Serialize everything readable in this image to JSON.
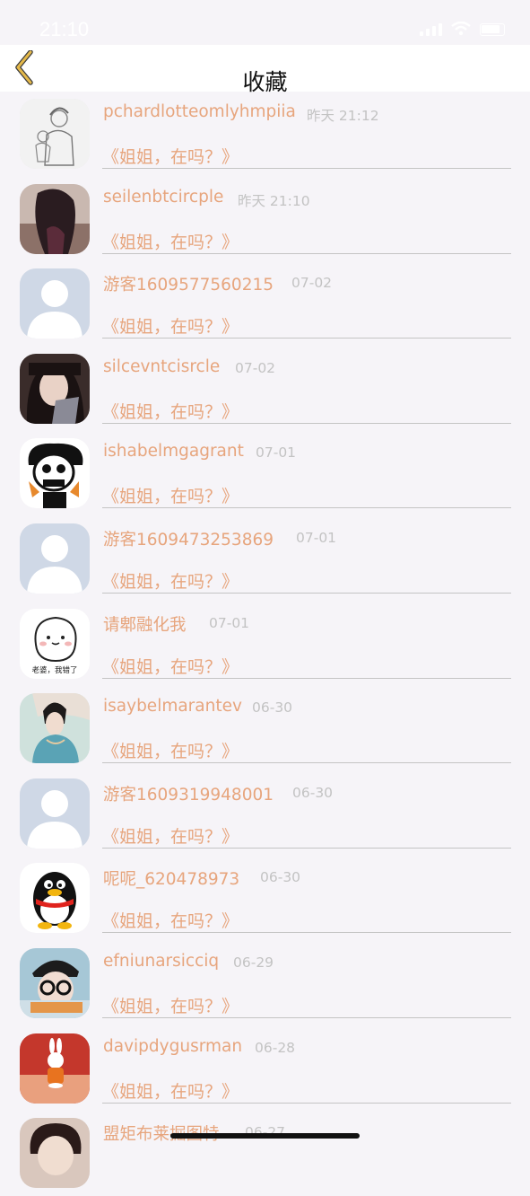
{
  "status_bar": {
    "time": "21:10",
    "icons": [
      "signal-icon",
      "wifi-icon",
      "battery-icon"
    ]
  },
  "nav": {
    "back_icon": "chevron-left-icon",
    "title": "收藏"
  },
  "colors": {
    "accent": "#e7a57d",
    "timestamp": "#c3c3c3",
    "divider": "#c4c4c4",
    "back_chevron": "#e5b94a"
  },
  "favorites": [
    {
      "name": "pchardlotteomlyhmpiia",
      "time": "昨天 21:12",
      "message": "《姐姐，在吗？》",
      "avatar": "sketch-mother-child-avatar"
    },
    {
      "name": "seilenbtcircple",
      "time": "昨天 21:10",
      "message": "《姐姐，在吗？》",
      "avatar": "girl-long-hair-avatar"
    },
    {
      "name": "游客1609577560215",
      "time": "07-02",
      "message": "《姐姐，在吗？》",
      "avatar": "default-person-avatar"
    },
    {
      "name": "silcevntcisrcle",
      "time": "07-02",
      "message": "《姐姐，在吗？》",
      "avatar": "girl-portrait-avatar"
    },
    {
      "name": "ishabelmgagrant",
      "time": "07-01",
      "message": "《姐姐，在吗？》",
      "avatar": "skeleton-cartoon-avatar"
    },
    {
      "name": "游客1609473253869",
      "time": "07-01",
      "message": "《姐姐，在吗？》",
      "avatar": "default-person-avatar"
    },
    {
      "name": "请郫融化我",
      "time": "07-01",
      "message": "《姐姐，在吗？》",
      "avatar": "cute-blob-avatar",
      "avatar_caption": "老婆，我错了"
    },
    {
      "name": "isaybelmarantev",
      "time": "06-30",
      "message": "《姐姐，在吗？》",
      "avatar": "hanfu-girl-avatar"
    },
    {
      "name": "游客1609319948001",
      "time": "06-30",
      "message": "《姐姐，在吗？》",
      "avatar": "default-person-avatar"
    },
    {
      "name": "呢呢_620478973",
      "time": "06-30",
      "message": "《姐姐，在吗？》",
      "avatar": "penguin-avatar"
    },
    {
      "name": "efniunarsicciq",
      "time": "06-29",
      "message": "《姐姐，在吗？》",
      "avatar": "cap-glasses-avatar"
    },
    {
      "name": "davipdygusrman",
      "time": "06-28",
      "message": "《姐姐，在吗？》",
      "avatar": "bunny-figure-avatar"
    },
    {
      "name": "盟矩布莱掘图特",
      "time": "06-27",
      "message": "",
      "avatar": "anime-boy-avatar"
    }
  ]
}
